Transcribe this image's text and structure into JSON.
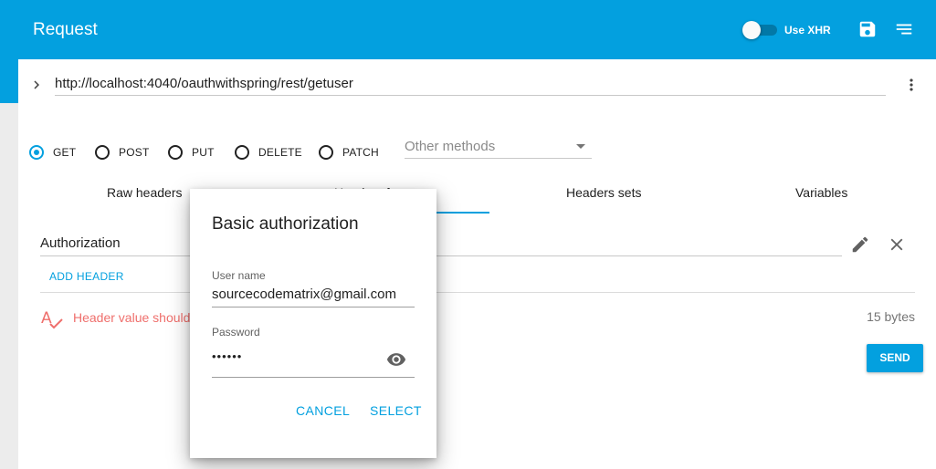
{
  "header": {
    "title": "Request",
    "xhr_label": "Use XHR",
    "xhr_enabled": false,
    "icons": [
      "save-icon",
      "sort-icon"
    ]
  },
  "url": {
    "value": "http://localhost:4040/oauthwithspring/rest/getuser"
  },
  "methods": {
    "options": [
      "GET",
      "POST",
      "PUT",
      "DELETE",
      "PATCH"
    ],
    "selected": "GET",
    "other_placeholder": "Other methods"
  },
  "tabs": {
    "items": [
      "Raw headers",
      "Headers form",
      "Headers sets",
      "Variables"
    ],
    "selected": "Headers form"
  },
  "headers_form": {
    "header_name": "Authorization",
    "add_header_label": "ADD HEADER",
    "warning_text": "Header value should",
    "size_text": "15 bytes",
    "send_label": "SEND"
  },
  "dialog": {
    "title": "Basic authorization",
    "username_label": "User name",
    "username_value": "sourcecodematrix@gmail.com",
    "password_label": "Password",
    "password_value": "••••••",
    "cancel_label": "CANCEL",
    "select_label": "SELECT"
  },
  "colors": {
    "accent": "#03a0df",
    "warning": "#ef6f6c"
  }
}
